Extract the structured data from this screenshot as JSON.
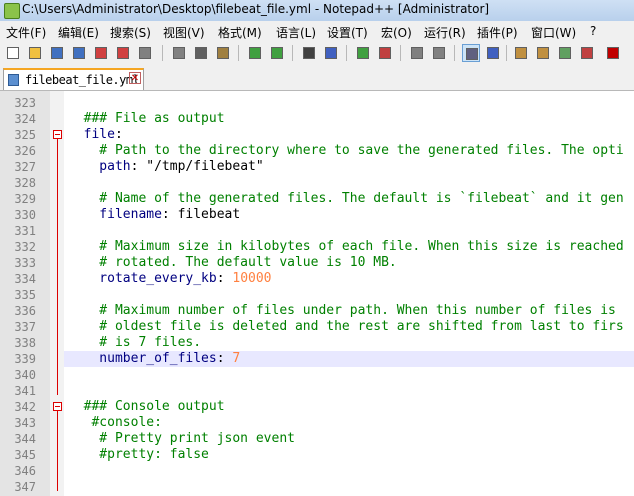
{
  "window": {
    "title": "C:\\Users\\Administrator\\Desktop\\filebeat_file.yml - Notepad++ [Administrator]"
  },
  "menu": [
    "文件(F)",
    "编辑(E)",
    "搜索(S)",
    "视图(V)",
    "格式(M)",
    "语言(L)",
    "设置(T)",
    "宏(O)",
    "运行(R)",
    "插件(P)",
    "窗口(W)",
    "?"
  ],
  "toolbar": [
    "new-icon",
    "open-icon",
    "save-icon",
    "save-all-icon",
    "close-icon",
    "close-all-icon",
    "print-icon",
    "cut-icon",
    "copy-icon",
    "paste-icon",
    "undo-icon",
    "redo-icon",
    "find-icon",
    "replace-icon",
    "zoom-in-icon",
    "zoom-out-icon",
    "sync-v-icon",
    "sync-h-icon",
    "word-wrap-icon",
    "all-chars-icon",
    "indent-guide-icon",
    "udl-icon",
    "doc-map-icon",
    "function-list-icon",
    "record-macro-icon",
    "stop-macro-icon"
  ],
  "tab": {
    "label": "filebeat_file.yml",
    "close": "✕"
  },
  "colors": {
    "comment": "#008000",
    "key": "#000080",
    "number": "#ff8040",
    "fold": "#dd0000"
  },
  "lines": [
    {
      "num": "323",
      "parts": []
    },
    {
      "num": "324",
      "parts": [
        {
          "t": "  ### File as output",
          "c": "c"
        }
      ]
    },
    {
      "num": "325",
      "parts": [
        {
          "t": "  file",
          "c": "k"
        },
        {
          "t": ":",
          "c": "v"
        }
      ]
    },
    {
      "num": "326",
      "parts": [
        {
          "t": "    # Path to the directory where to save the generated files. The opti",
          "c": "c"
        }
      ]
    },
    {
      "num": "327",
      "parts": [
        {
          "t": "    path",
          "c": "k"
        },
        {
          "t": ": \"/tmp/filebeat\"",
          "c": "v"
        }
      ]
    },
    {
      "num": "328",
      "parts": []
    },
    {
      "num": "329",
      "parts": [
        {
          "t": "    # Name of the generated files. The default is `filebeat` and it gen",
          "c": "c"
        }
      ]
    },
    {
      "num": "330",
      "parts": [
        {
          "t": "    filename",
          "c": "k"
        },
        {
          "t": ": filebeat",
          "c": "v"
        }
      ]
    },
    {
      "num": "331",
      "parts": []
    },
    {
      "num": "332",
      "parts": [
        {
          "t": "    # Maximum size in kilobytes of each file. When this size is reached",
          "c": "c"
        }
      ]
    },
    {
      "num": "333",
      "parts": [
        {
          "t": "    # rotated. The default value is 10 MB.",
          "c": "c"
        }
      ]
    },
    {
      "num": "334",
      "parts": [
        {
          "t": "    rotate_every_kb",
          "c": "k"
        },
        {
          "t": ": ",
          "c": "v"
        },
        {
          "t": "10000",
          "c": "n"
        }
      ]
    },
    {
      "num": "335",
      "parts": []
    },
    {
      "num": "336",
      "parts": [
        {
          "t": "    # Maximum number of files under path. When this number of files is",
          "c": "c"
        }
      ]
    },
    {
      "num": "337",
      "parts": [
        {
          "t": "    # oldest file is deleted and the rest are shifted from last to firs",
          "c": "c"
        }
      ]
    },
    {
      "num": "338",
      "parts": [
        {
          "t": "    # is 7 files.",
          "c": "c"
        }
      ]
    },
    {
      "num": "339",
      "parts": [
        {
          "t": "    number_of_files",
          "c": "k"
        },
        {
          "t": ": ",
          "c": "v"
        },
        {
          "t": "7",
          "c": "n"
        }
      ]
    },
    {
      "num": "340",
      "parts": []
    },
    {
      "num": "341",
      "parts": []
    },
    {
      "num": "342",
      "parts": [
        {
          "t": "  ### Console output",
          "c": "c"
        }
      ]
    },
    {
      "num": "343",
      "parts": [
        {
          "t": "   #console:",
          "c": "c"
        }
      ]
    },
    {
      "num": "344",
      "parts": [
        {
          "t": "    # Pretty print json event",
          "c": "c"
        }
      ]
    },
    {
      "num": "345",
      "parts": [
        {
          "t": "    #pretty: false",
          "c": "c"
        }
      ]
    },
    {
      "num": "346",
      "parts": []
    },
    {
      "num": "347",
      "parts": []
    }
  ]
}
